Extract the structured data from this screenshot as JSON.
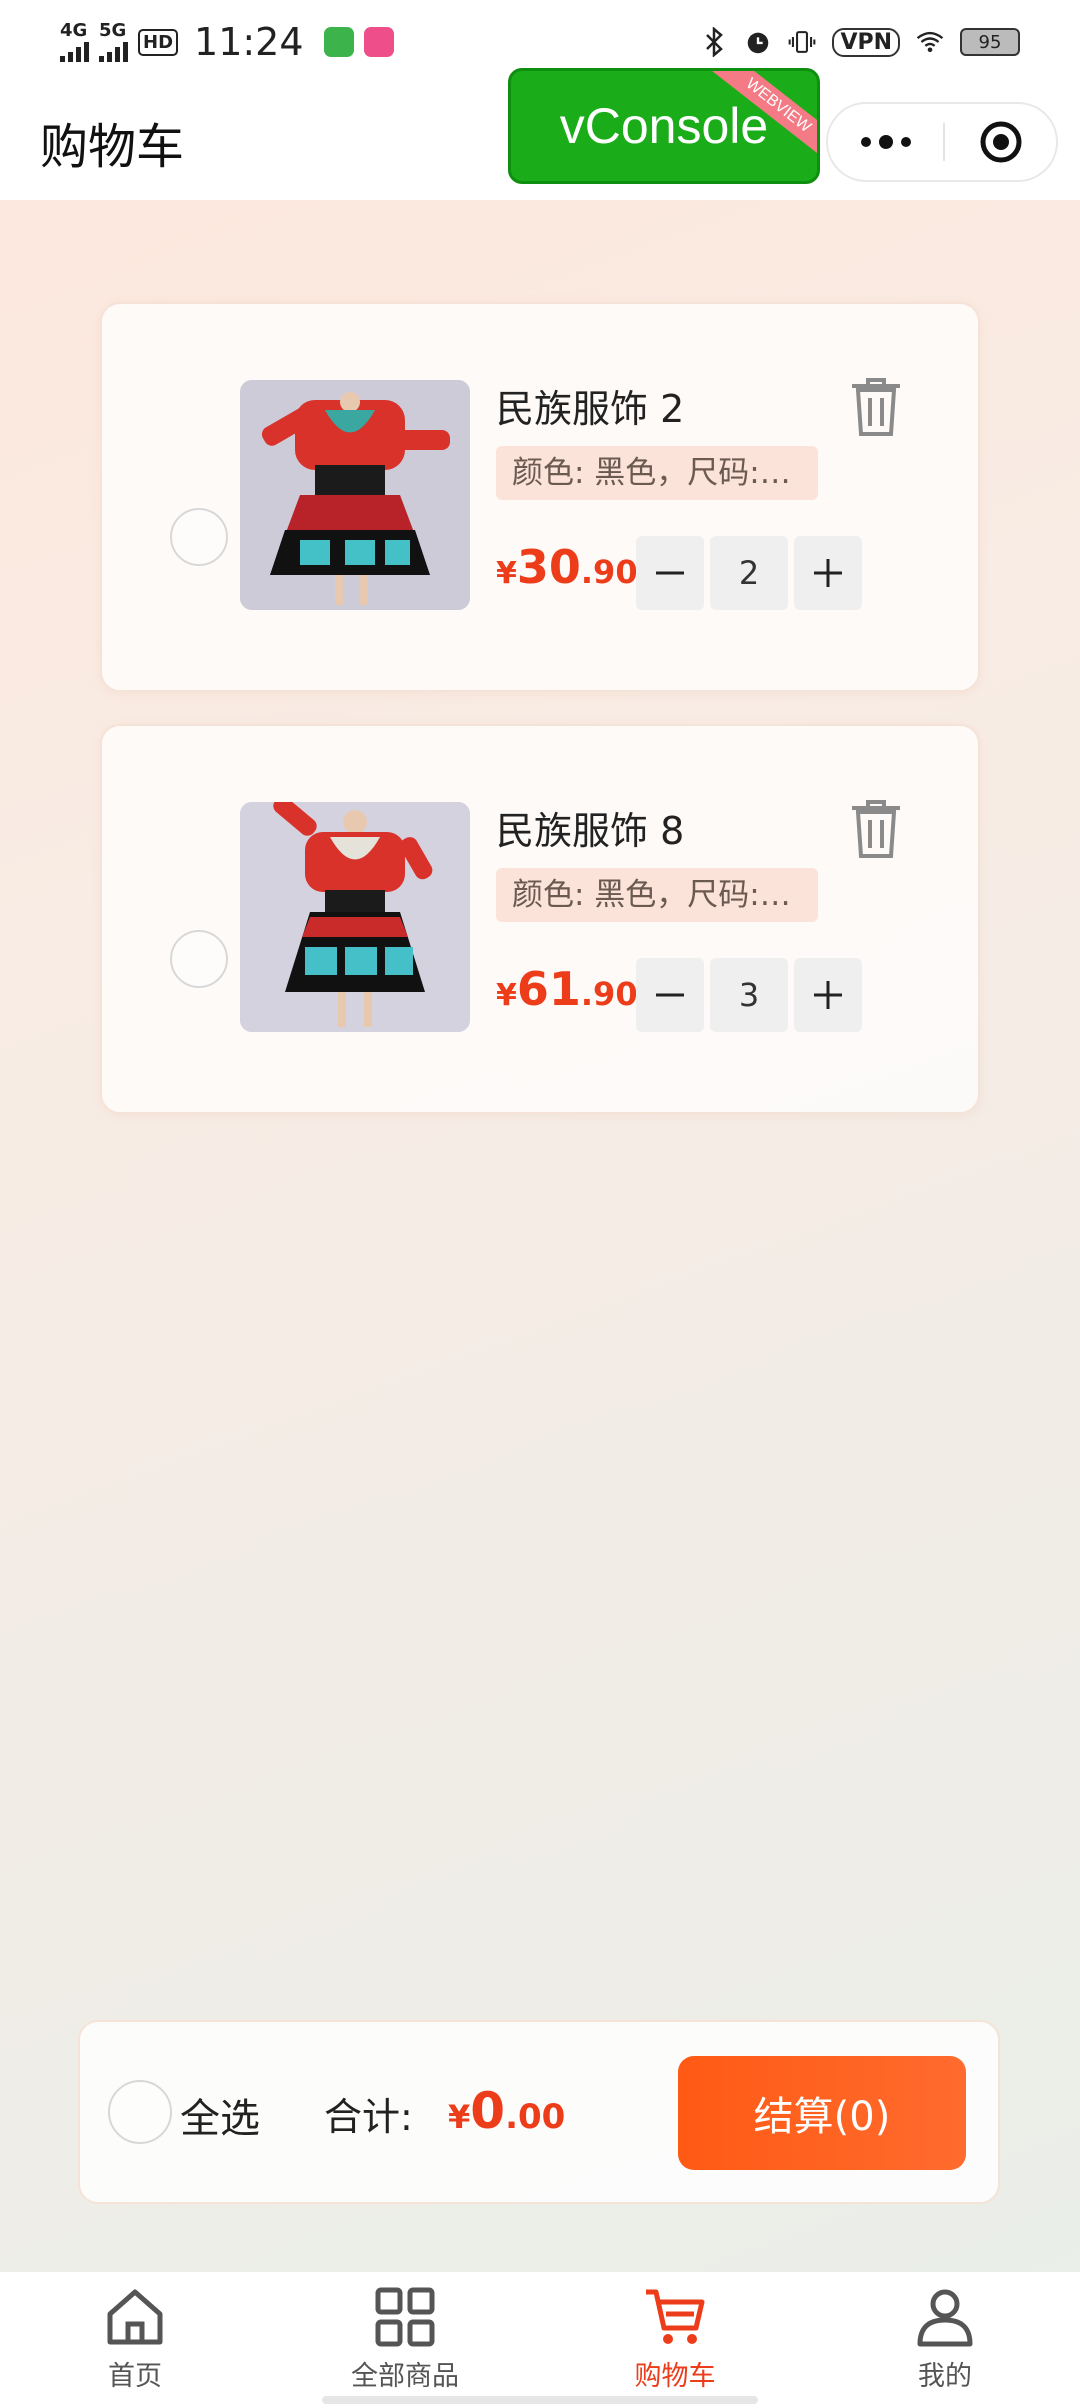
{
  "status_bar": {
    "net1": "4G",
    "net2": "5G",
    "hd": "HD",
    "time": "11:24",
    "vpn": "VPN",
    "battery": "95"
  },
  "header": {
    "title": "购物车",
    "vconsole_label": "vConsole",
    "vconsole_ribbon": "WEBVIEW"
  },
  "cart": {
    "items": [
      {
        "name": "民族服饰 2",
        "spec": "颜色: 黑色，尺码:…",
        "price_currency": "¥",
        "price_int": "30",
        "price_dec": ".90",
        "quantity": "2",
        "selected": false
      },
      {
        "name": "民族服饰 8",
        "spec": "颜色: 黑色，尺码:…",
        "price_currency": "¥",
        "price_int": "61",
        "price_dec": ".90",
        "quantity": "3",
        "selected": false
      }
    ]
  },
  "checkout": {
    "select_all_label": "全选",
    "total_label": "合计:",
    "total_currency": "¥",
    "total_int": "0",
    "total_dec": ".00",
    "button_label": "结算(0)"
  },
  "tabbar": {
    "tabs": [
      {
        "label": "首页",
        "icon": "home-icon",
        "active": false
      },
      {
        "label": "全部商品",
        "icon": "grid-icon",
        "active": false
      },
      {
        "label": "购物车",
        "icon": "cart-icon",
        "active": true
      },
      {
        "label": "我的",
        "icon": "user-icon",
        "active": false
      }
    ]
  },
  "colors": {
    "accent": "#ec3c1a",
    "checkout_button": "#ff5a14",
    "vconsole": "#1aad19"
  }
}
